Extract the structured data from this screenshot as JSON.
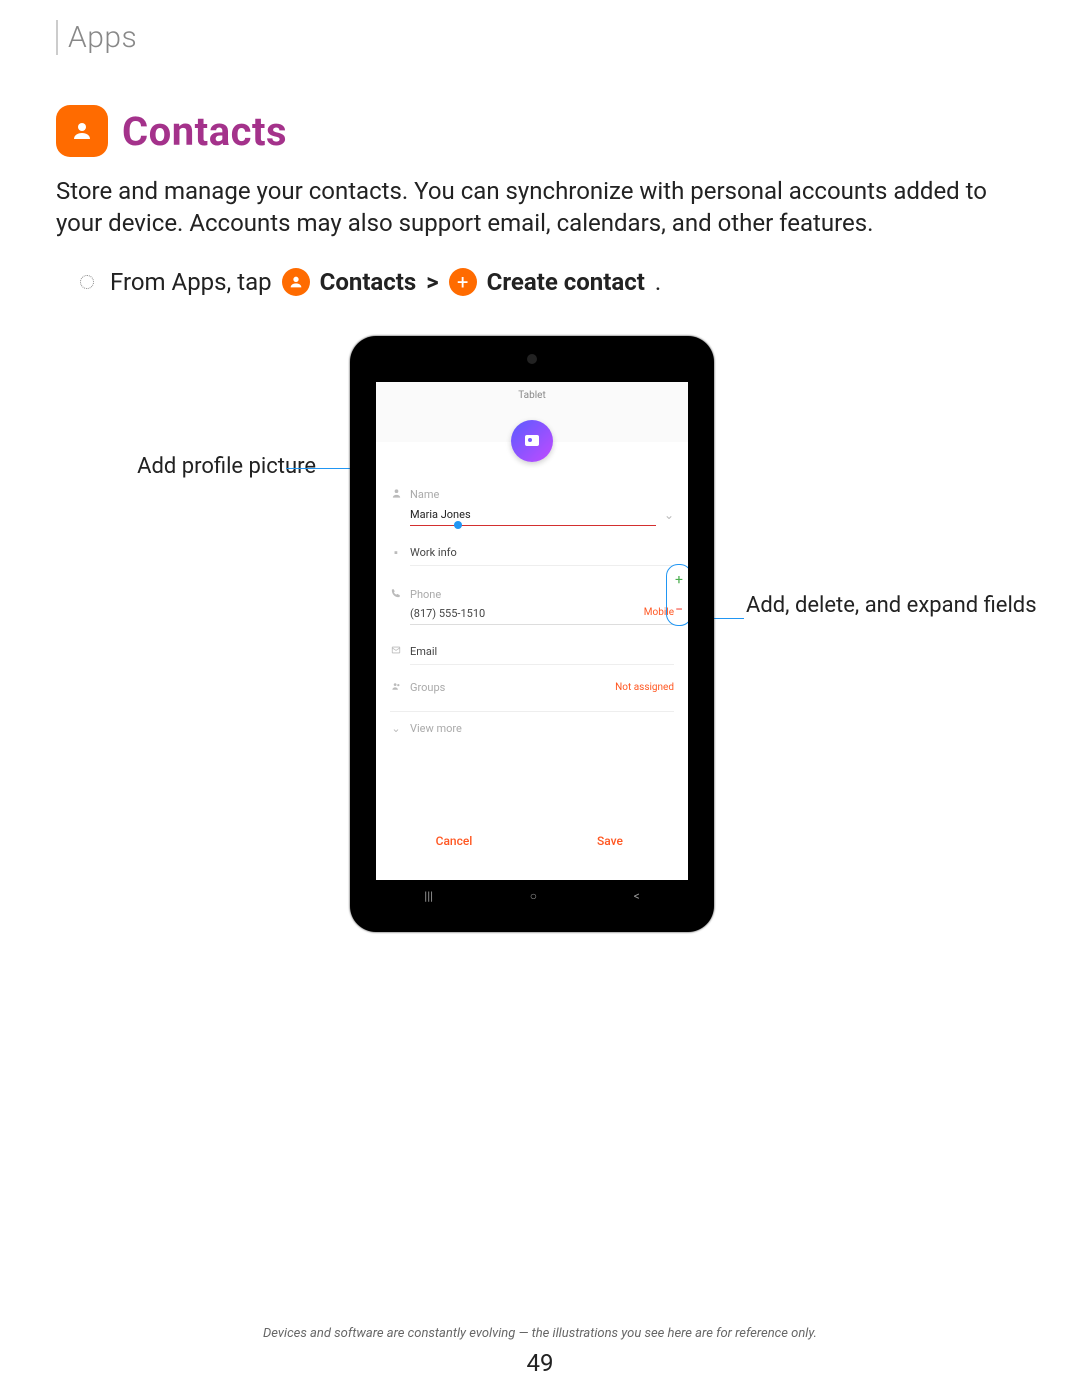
{
  "breadcrumb": "Apps",
  "title": "Contacts",
  "intro": "Store and manage your contacts. You can synchronize with personal accounts added to your device. Accounts may also support email, calendars, and other features.",
  "step": {
    "prefix": "From Apps, tap",
    "contacts": "Contacts",
    "chevron": ">",
    "create": "Create contact",
    "period": "."
  },
  "callouts": {
    "left": "Add profile picture",
    "right": "Add, delete, and expand fields"
  },
  "tablet": {
    "header": "Tablet",
    "name_label": "Name",
    "name_value": "Maria Jones",
    "work_label": "Work info",
    "phone_label": "Phone",
    "phone_value": "(817) 555-1510",
    "phone_type": "Mobile",
    "email_label": "Email",
    "groups_label": "Groups",
    "groups_value": "Not assigned",
    "viewmore": "View more",
    "cancel": "Cancel",
    "save": "Save"
  },
  "disclaimer": "Devices and software are constantly evolving — the illustrations you see here are for reference only.",
  "page_number": "49"
}
